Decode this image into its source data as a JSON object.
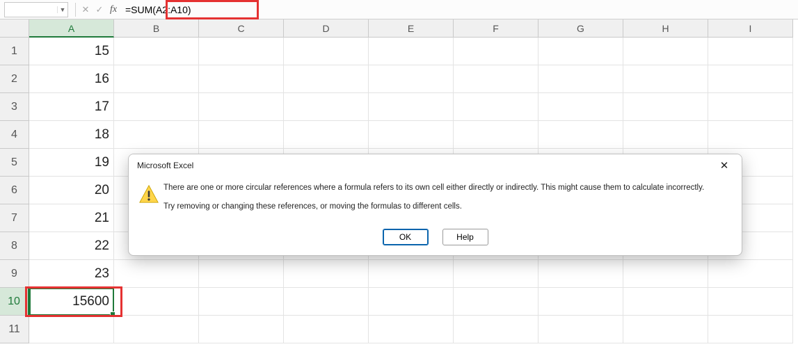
{
  "formula_bar": {
    "name_box": "",
    "formula": "=SUM(A2:A10)",
    "fx_label": "fx"
  },
  "columns": [
    "A",
    "B",
    "C",
    "D",
    "E",
    "F",
    "G",
    "H",
    "I"
  ],
  "rows": [
    "1",
    "2",
    "3",
    "4",
    "5",
    "6",
    "7",
    "8",
    "9",
    "10",
    "11"
  ],
  "active_col_index": 0,
  "active_row_index": 9,
  "cells": {
    "A1": "15",
    "A2": "16",
    "A3": "17",
    "A4": "18",
    "A5": "19",
    "A6": "20",
    "A7": "21",
    "A8": "22",
    "A9": "23",
    "A10": "15600"
  },
  "dialog": {
    "title": "Microsoft Excel",
    "line1": "There are one or more circular references where a formula refers to its own cell either directly or indirectly. This might cause them to calculate incorrectly.",
    "line2": "Try removing or changing these references, or moving the formulas to different cells.",
    "ok": "OK",
    "help": "Help"
  }
}
